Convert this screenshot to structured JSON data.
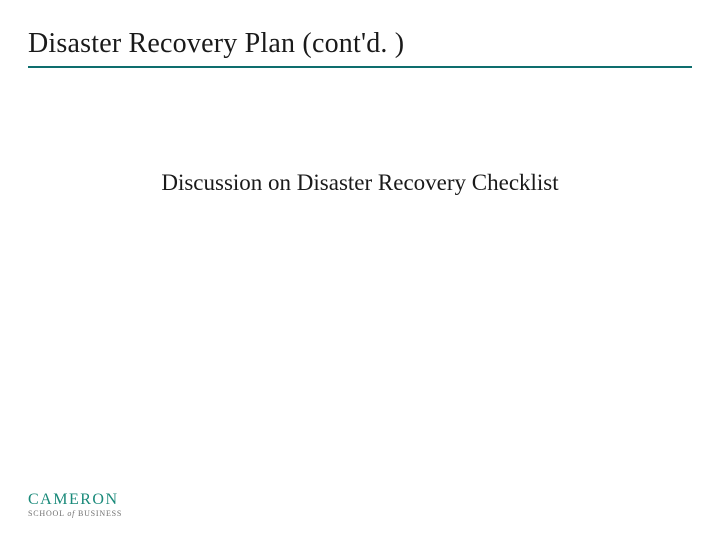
{
  "header": {
    "title": "Disaster Recovery Plan (cont'd. )"
  },
  "body": {
    "text": "Discussion on Disaster Recovery Checklist"
  },
  "footer": {
    "logo_main": "CAMERON",
    "logo_sub_1": "SCHOOL",
    "logo_sub_of": "of",
    "logo_sub_2": "BUSINESS"
  },
  "colors": {
    "rule": "#0e6e6e",
    "logo": "#1a8a7a"
  }
}
